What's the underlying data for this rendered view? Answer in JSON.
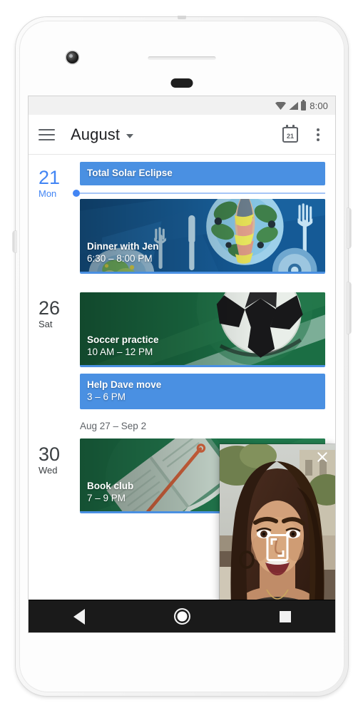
{
  "device": {
    "camera_icon": "front-camera",
    "earpiece_icon": "earpiece-speaker",
    "sensor_icon": "proximity-sensor"
  },
  "status_bar": {
    "wifi_icon": "wifi-icon",
    "signal_icon": "cell-signal-icon",
    "battery_icon": "battery-icon",
    "time": "8:00"
  },
  "app_bar": {
    "menu_icon": "hamburger-menu-icon",
    "title": "August",
    "dropdown_icon": "chevron-down-icon",
    "today_icon_label": "21",
    "today_icon": "calendar-today-icon",
    "overflow_icon": "overflow-menu-icon"
  },
  "agenda": {
    "days": [
      {
        "date": "21",
        "dow": "Mon",
        "today": true,
        "events": [
          {
            "title": "Total Solar Eclipse",
            "time": "",
            "style": "flat",
            "art": "none",
            "color": "#4a90e2"
          },
          {
            "title": "Dinner with Jen",
            "time": "6:30 – 8:00 PM",
            "style": "tall",
            "art": "dinner",
            "color": "#15538c"
          }
        ]
      },
      {
        "date": "26",
        "dow": "Sat",
        "today": false,
        "events": [
          {
            "title": "Soccer practice",
            "time": "10 AM – 12 PM",
            "style": "tall",
            "art": "soccer",
            "color": "#1d7044"
          },
          {
            "title": "Help Dave move",
            "time": "3 – 6 PM",
            "style": "flat",
            "art": "none",
            "color": "#4a90e2"
          }
        ]
      }
    ],
    "week_label": "Aug 27 – Sep 2",
    "days2": [
      {
        "date": "30",
        "dow": "Wed",
        "today": false,
        "events": [
          {
            "title": "Book club",
            "time": "7 – 9 PM",
            "style": "tall",
            "art": "book",
            "color": "#1f7a4d"
          }
        ]
      }
    ]
  },
  "pip": {
    "close_icon": "close-icon",
    "expand_icon": "expand-to-fullscreen-icon",
    "content": "video-call-participant"
  },
  "nav_bar": {
    "back_icon": "back-triangle-icon",
    "home_icon": "home-circle-icon",
    "recents_icon": "recents-square-icon"
  },
  "colors": {
    "accent": "#4285f4",
    "event_blue": "#4a90e2",
    "event_green": "#1d7044",
    "event_navy": "#15538c",
    "nav_bar": "#1a1a1a",
    "status_bar": "#f1f1f1"
  }
}
